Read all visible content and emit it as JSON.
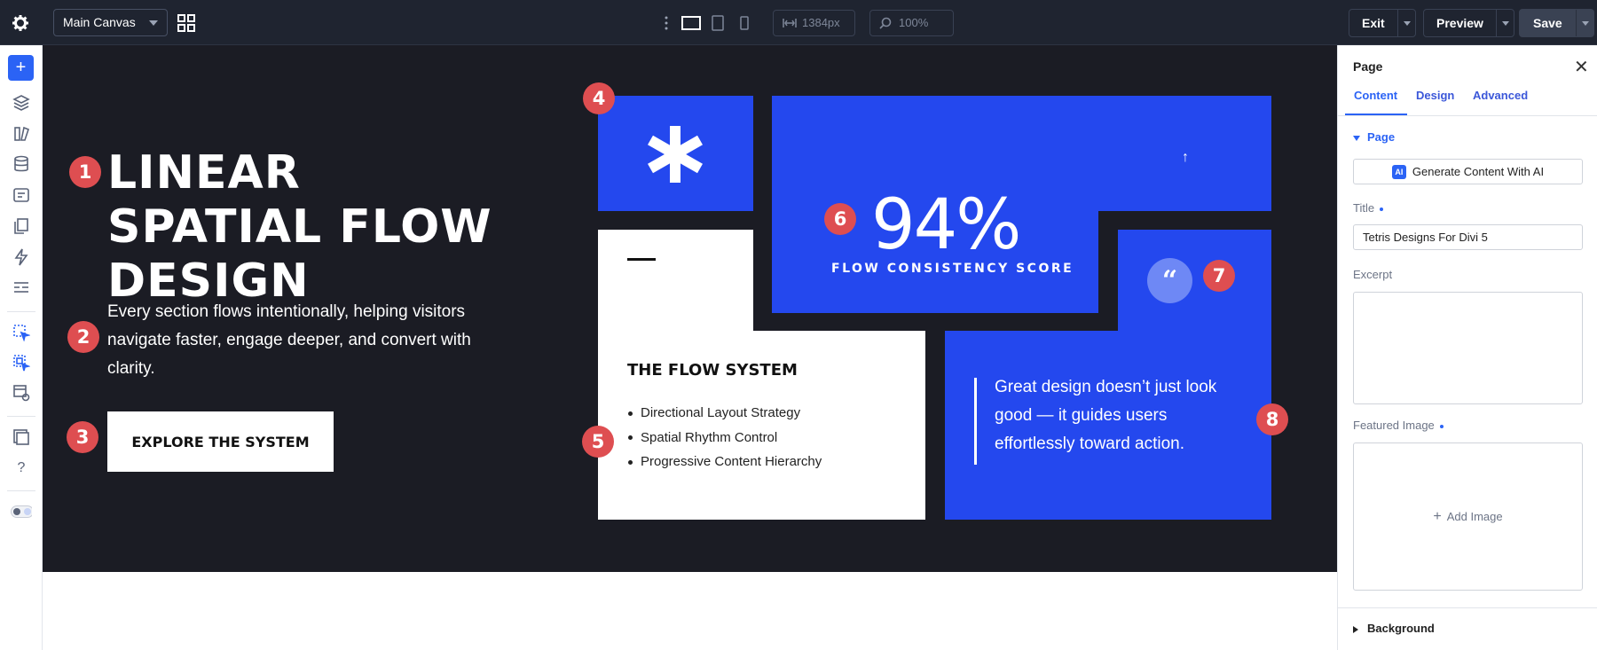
{
  "topbar": {
    "canvas_select": "Main Canvas",
    "width_value": "1384px",
    "zoom_value": "100%",
    "exit_label": "Exit",
    "preview_label": "Preview",
    "save_label": "Save"
  },
  "hero": {
    "title": "LINEAR SPATIAL FLOW DESIGN",
    "description": "Every section flows intentionally, helping visitors navigate faster, engage deeper, and convert with clarity.",
    "cta_label": "EXPLORE THE SYSTEM",
    "score_value": "94%",
    "score_label": "FLOW CONSISTENCY SCORE",
    "flow_heading": "THE FLOW SYSTEM",
    "flow_items": [
      "Directional Layout Strategy",
      "Spatial Rhythm Control",
      "Progressive Content Hierarchy"
    ],
    "quote_mark": "“",
    "quote": "Great design doesn’t just look good — it guides users effortlessly toward action.",
    "arrow": "↑",
    "badges": [
      "1",
      "2",
      "3",
      "4",
      "5",
      "6",
      "7",
      "8"
    ]
  },
  "panel": {
    "title": "Page",
    "tabs": [
      "Content",
      "Design",
      "Advanced"
    ],
    "section": "Page",
    "ai_chip": "AI",
    "ai_button": "Generate Content With AI",
    "title_label": "Title",
    "title_value": "Tetris Designs For Divi 5",
    "excerpt_label": "Excerpt",
    "featured_label": "Featured Image",
    "add_image": "Add Image",
    "background": "Background"
  },
  "colors": {
    "accent": "#2b63f5",
    "block_blue": "#2448ee",
    "dark_bg": "#1b1c24",
    "badge_red": "#de4e51"
  }
}
